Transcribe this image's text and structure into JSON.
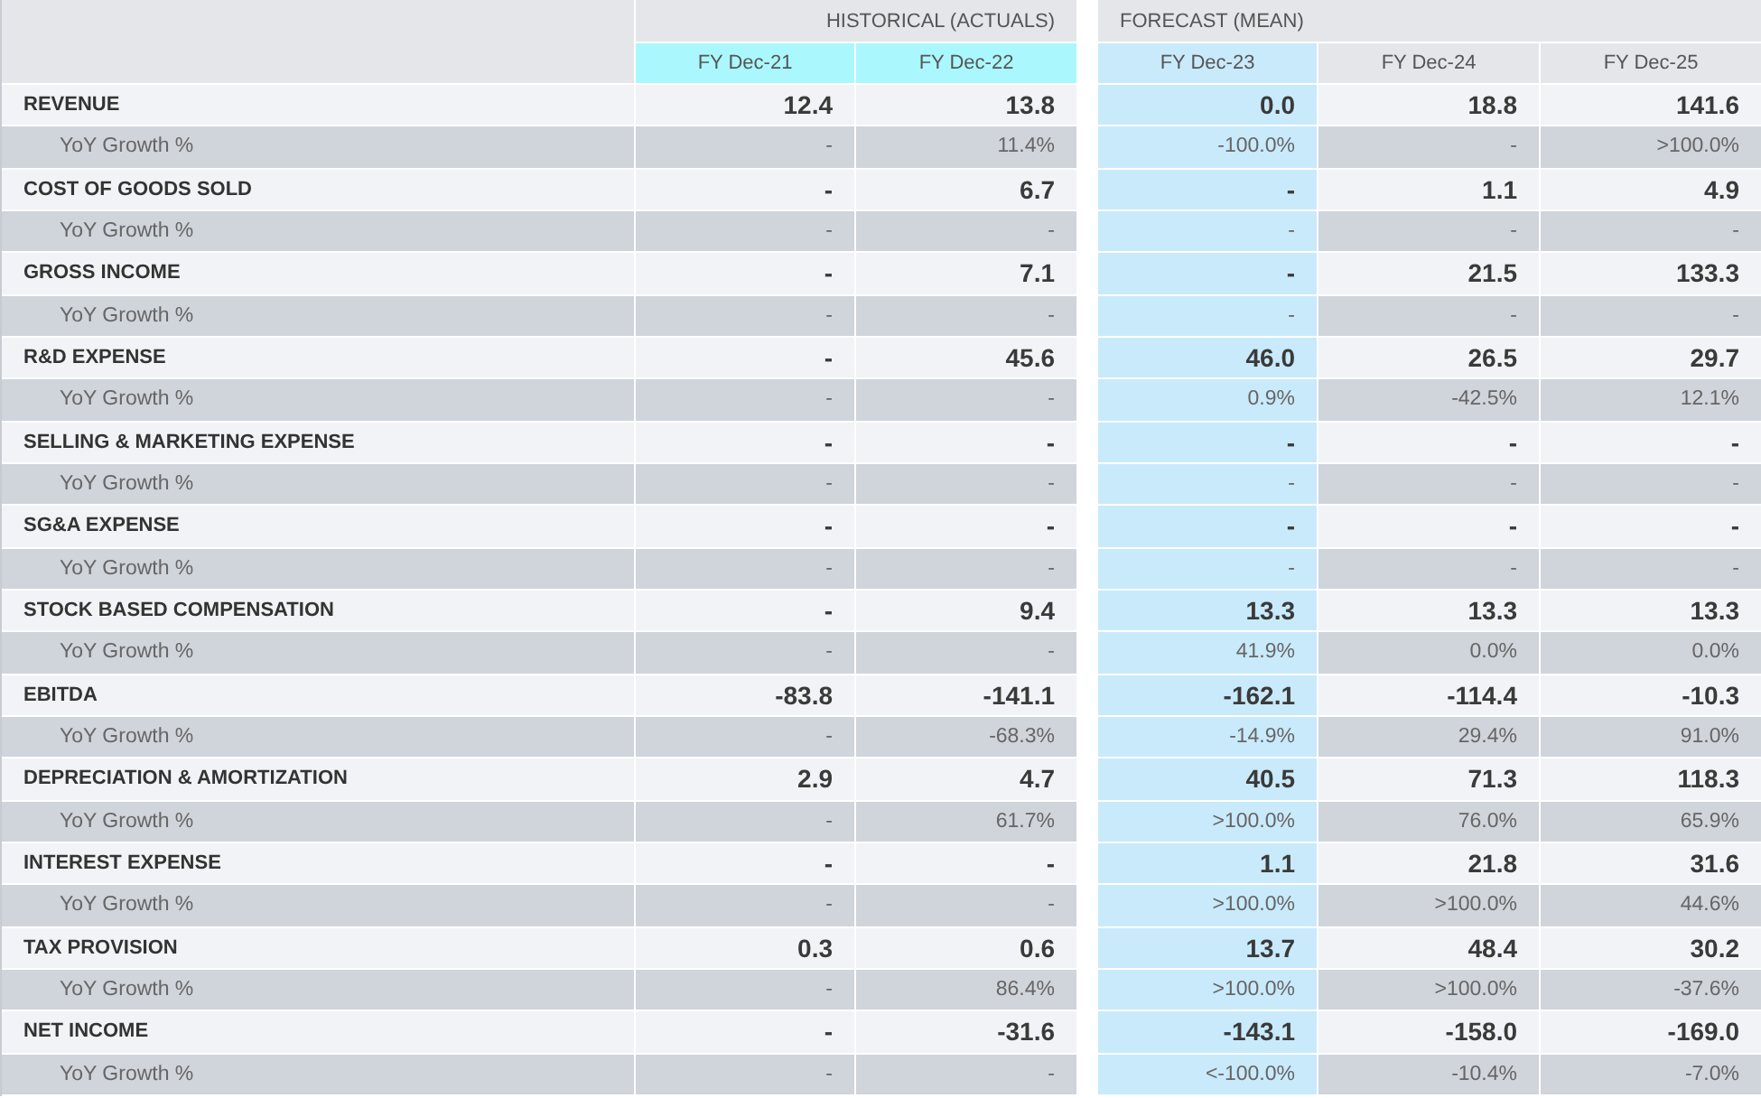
{
  "groups": [
    {
      "label": "HISTORICAL (ACTUALS)",
      "kind": "historical",
      "columns": [
        {
          "label": "FY Dec-21",
          "selected": false
        },
        {
          "label": "FY Dec-22",
          "selected": false
        }
      ]
    },
    {
      "label": "FORECAST (MEAN)",
      "kind": "forecast",
      "columns": [
        {
          "label": "FY Dec-23",
          "selected": true
        },
        {
          "label": "FY Dec-24",
          "selected": false
        },
        {
          "label": "FY Dec-25",
          "selected": false
        }
      ]
    }
  ],
  "rows": [
    {
      "kind": "item",
      "label": "REVENUE",
      "values": [
        "12.4",
        "13.8",
        "0.0",
        "18.8",
        "141.6"
      ]
    },
    {
      "kind": "growth",
      "label": "YoY Growth %",
      "values": [
        "-",
        "11.4%",
        "-100.0%",
        "-",
        ">100.0%"
      ]
    },
    {
      "kind": "item",
      "label": "COST OF GOODS SOLD",
      "values": [
        "-",
        "6.7",
        "-",
        "1.1",
        "4.9"
      ]
    },
    {
      "kind": "growth",
      "label": "YoY Growth %",
      "values": [
        "-",
        "-",
        "-",
        "-",
        "-"
      ]
    },
    {
      "kind": "item",
      "label": "GROSS INCOME",
      "values": [
        "-",
        "7.1",
        "-",
        "21.5",
        "133.3"
      ]
    },
    {
      "kind": "growth",
      "label": "YoY Growth %",
      "values": [
        "-",
        "-",
        "-",
        "-",
        "-"
      ]
    },
    {
      "kind": "item",
      "label": "R&D EXPENSE",
      "values": [
        "-",
        "45.6",
        "46.0",
        "26.5",
        "29.7"
      ]
    },
    {
      "kind": "growth",
      "label": "YoY Growth %",
      "values": [
        "-",
        "-",
        "0.9%",
        "-42.5%",
        "12.1%"
      ]
    },
    {
      "kind": "item",
      "label": "SELLING & MARKETING EXPENSE",
      "values": [
        "-",
        "-",
        "-",
        "-",
        "-"
      ]
    },
    {
      "kind": "growth",
      "label": "YoY Growth %",
      "values": [
        "-",
        "-",
        "-",
        "-",
        "-"
      ]
    },
    {
      "kind": "item",
      "label": "SG&A EXPENSE",
      "values": [
        "-",
        "-",
        "-",
        "-",
        "-"
      ]
    },
    {
      "kind": "growth",
      "label": "YoY Growth %",
      "values": [
        "-",
        "-",
        "-",
        "-",
        "-"
      ]
    },
    {
      "kind": "item",
      "label": "STOCK BASED COMPENSATION",
      "values": [
        "-",
        "9.4",
        "13.3",
        "13.3",
        "13.3"
      ]
    },
    {
      "kind": "growth",
      "label": "YoY Growth %",
      "values": [
        "-",
        "-",
        "41.9%",
        "0.0%",
        "0.0%"
      ]
    },
    {
      "kind": "item",
      "label": "EBITDA",
      "values": [
        "-83.8",
        "-141.1",
        "-162.1",
        "-114.4",
        "-10.3"
      ]
    },
    {
      "kind": "growth",
      "label": "YoY Growth %",
      "values": [
        "-",
        "-68.3%",
        "-14.9%",
        "29.4%",
        "91.0%"
      ]
    },
    {
      "kind": "item",
      "label": "DEPRECIATION & AMORTIZATION",
      "values": [
        "2.9",
        "4.7",
        "40.5",
        "71.3",
        "118.3"
      ]
    },
    {
      "kind": "growth",
      "label": "YoY Growth %",
      "values": [
        "-",
        "61.7%",
        ">100.0%",
        "76.0%",
        "65.9%"
      ]
    },
    {
      "kind": "item",
      "label": "INTEREST EXPENSE",
      "values": [
        "-",
        "-",
        "1.1",
        "21.8",
        "31.6"
      ]
    },
    {
      "kind": "growth",
      "label": "YoY Growth %",
      "values": [
        "-",
        "-",
        ">100.0%",
        ">100.0%",
        "44.6%"
      ]
    },
    {
      "kind": "item",
      "label": "TAX PROVISION",
      "values": [
        "0.3",
        "0.6",
        "13.7",
        "48.4",
        "30.2"
      ]
    },
    {
      "kind": "growth",
      "label": "YoY Growth %",
      "values": [
        "-",
        "86.4%",
        ">100.0%",
        ">100.0%",
        "-37.6%"
      ]
    },
    {
      "kind": "item",
      "label": "NET INCOME",
      "values": [
        "-",
        "-31.6",
        "-143.1",
        "-158.0",
        "-169.0"
      ]
    },
    {
      "kind": "growth",
      "label": "YoY Growth %",
      "values": [
        "-",
        "-",
        "<-100.0%",
        "-10.4%",
        "-7.0%"
      ]
    }
  ]
}
